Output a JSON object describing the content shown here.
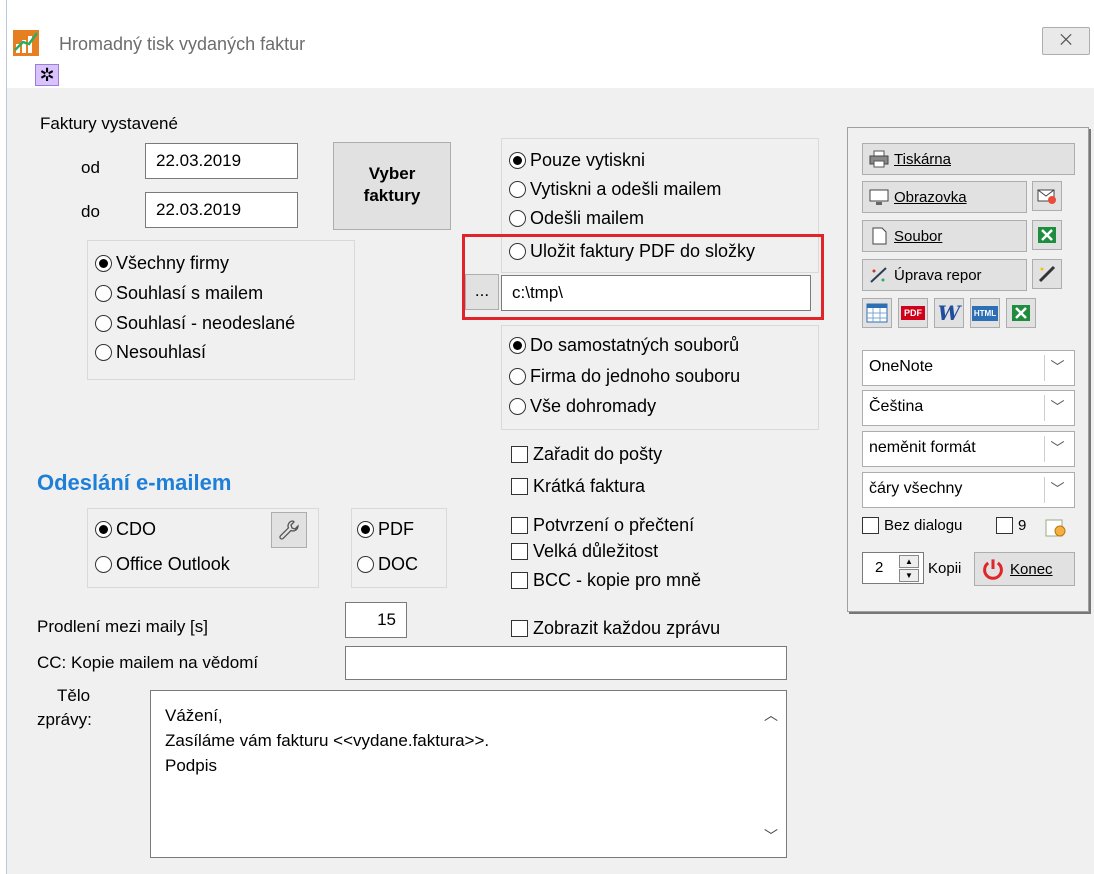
{
  "window": {
    "title": "Hromadný tisk vydaných faktur",
    "close_glyph": "⨉"
  },
  "invoices": {
    "section_label": "Faktury vystavené",
    "from_label": "od",
    "from_value": "22.03.2019",
    "to_label": "do",
    "to_value": "22.03.2019",
    "select_button_line1": "Vyber",
    "select_button_line2": "faktury"
  },
  "firms_filter": {
    "options": [
      "Všechny firmy",
      "Souhlasí s mailem",
      "Souhlasí - neodeslané",
      "Nesouhlasí"
    ],
    "selected": 0
  },
  "action": {
    "options": [
      "Pouze vytiskni",
      "Vytiskni a odešli mailem",
      "Odešli mailem",
      "Uložit faktury PDF do složky"
    ],
    "selected": 0,
    "browse_label": "...",
    "folder_value": "c:\\tmp\\"
  },
  "file_mode": {
    "options": [
      "Do samostatných souborů",
      "Firma do jednoho souboru",
      "Vše dohromady"
    ],
    "selected": 0
  },
  "checks": {
    "post": "Zařadit do pošty",
    "short": "Krátká faktura",
    "read_receipt": "Potvrzení o přečtení",
    "importance": "Velká důležitost",
    "bcc": "BCC - kopie pro mně",
    "show_each": "Zobrazit každou zprávu"
  },
  "email": {
    "heading": "Odeslání e-mailem",
    "client_options": [
      "CDO",
      "Office Outlook"
    ],
    "client_selected": 0,
    "format_options": [
      "PDF",
      "DOC"
    ],
    "format_selected": 0,
    "delay_label": "Prodlení mezi maily [s]",
    "delay_value": "15",
    "cc_label": "CC: Kopie mailem na vědomí",
    "cc_value": "",
    "body_label_line1": "Tělo",
    "body_label_line2": "zprávy:",
    "body_lines": [
      "Vážení,",
      "Zasíláme vám fakturu <<vydane.faktura>>.",
      "Podpis"
    ]
  },
  "panel": {
    "printer_label": "Tiskárna",
    "screen_label": "Obrazovka",
    "file_label": "Soubor",
    "edit_report_label": "Úprava repor",
    "combo_onenote": "OneNote",
    "combo_language": "Čeština",
    "combo_format": "neměnit formát",
    "combo_lines": "čáry všechny",
    "no_dialog_label": "Bez dialogu",
    "nine_label": "9",
    "copies_value": "2",
    "copies_label": "Kopii",
    "end_label": "Konec",
    "export_pdf": "PDF",
    "export_word": "W",
    "export_html": "HTML"
  },
  "colors": {
    "accent": "#1e7fd9",
    "highlight_frame": "#e0242a",
    "gear_bg": "#d9c3ff"
  }
}
